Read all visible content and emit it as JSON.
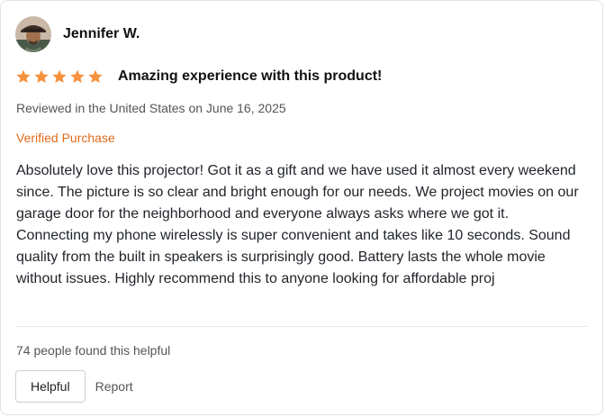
{
  "review": {
    "reviewer_name": "Jennifer W.",
    "rating": 5,
    "rating_max": 5,
    "star_color": "#f7913d",
    "title": "Amazing experience with this product!",
    "meta": "Reviewed in the United States on June 16, 2025",
    "verified": "Verified Purchase",
    "verified_color": "#e06a1b",
    "body": "Absolutely love this projector! Got it as a gift and we have used it almost every weekend since. The picture is so clear and bright enough for our needs. We project movies on our garage door for the neighborhood and everyone always asks where we got it. Connecting my phone wirelessly is super convenient and takes like 10 seconds. Sound quality from the built in speakers is surprisingly good. Battery lasts the whole movie without issues. Highly recommend this to anyone looking for affordable proj",
    "helpful_count": "74 people found this helpful"
  },
  "actions": {
    "helpful_label": "Helpful",
    "report_label": "Report"
  },
  "icons": {
    "avatar": "reviewer-avatar-photo",
    "star": "star-icon"
  }
}
